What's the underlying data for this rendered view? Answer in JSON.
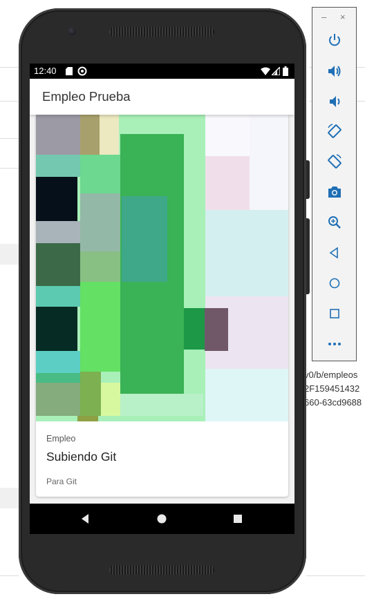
{
  "device": {
    "status_time": "12:40"
  },
  "app": {
    "title": "Empleo Prueba",
    "card": {
      "category": "Empleo",
      "title": "Subiendo Git",
      "subtitle": "Para Git"
    }
  },
  "background_text": {
    "url_lines": [
      "v0/b/empleos",
      "2F159451432",
      "660-63cd9688"
    ]
  },
  "emulator_toolbar": {
    "minimize_label": "–",
    "close_label": "×",
    "tools": [
      "power-icon",
      "volume-up-icon",
      "volume-down-icon",
      "rotate-left-icon",
      "rotate-right-icon",
      "camera-icon",
      "zoom-icon",
      "back-icon",
      "home-icon",
      "overview-icon",
      "more-icon"
    ]
  },
  "colors": {
    "accent_green": "#3aa655",
    "bezel": "#2a2a2a",
    "toolbar_icon": "#1f6fb5"
  }
}
